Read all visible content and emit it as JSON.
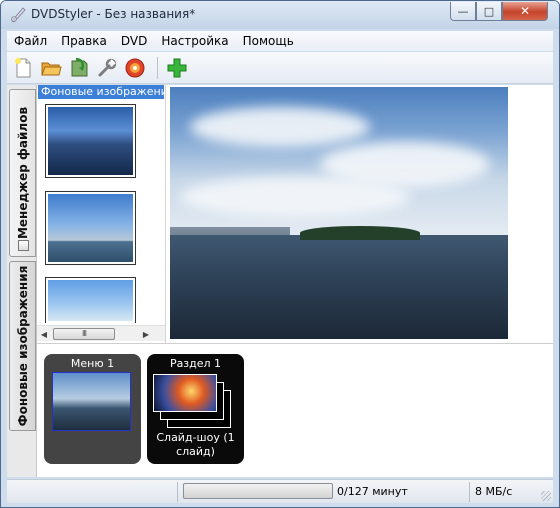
{
  "window": {
    "title": "DVDStyler - Без названия*",
    "controls": {
      "minimize": "—",
      "maximize": "□",
      "close": "✕"
    }
  },
  "menu": {
    "items": [
      "Файл",
      "Правка",
      "DVD",
      "Настройка",
      "Помощь"
    ]
  },
  "toolbar": {
    "buttons": [
      "new-icon",
      "open-icon",
      "save-icon",
      "settings-icon",
      "burn-icon",
      "add-icon"
    ]
  },
  "sidebar": {
    "tabs": [
      {
        "label": "Менеджер файлов",
        "active": false
      },
      {
        "label": "Фоновые изображения",
        "active": true
      }
    ]
  },
  "thumb_panel": {
    "header": "Фоновые изображения",
    "hscroll_grip": "III"
  },
  "titleset": {
    "menu": {
      "label": "Меню 1"
    },
    "section": {
      "label": "Раздел 1",
      "caption": "Слайд-шоу (1 слайд)"
    }
  },
  "status": {
    "progress": 0,
    "time": "0/127 минут",
    "size": "8 МБ/с"
  },
  "colors": {
    "accent": "#3c7fd6",
    "progress_fill": "#37b81c",
    "close_button": "#c5432a"
  }
}
